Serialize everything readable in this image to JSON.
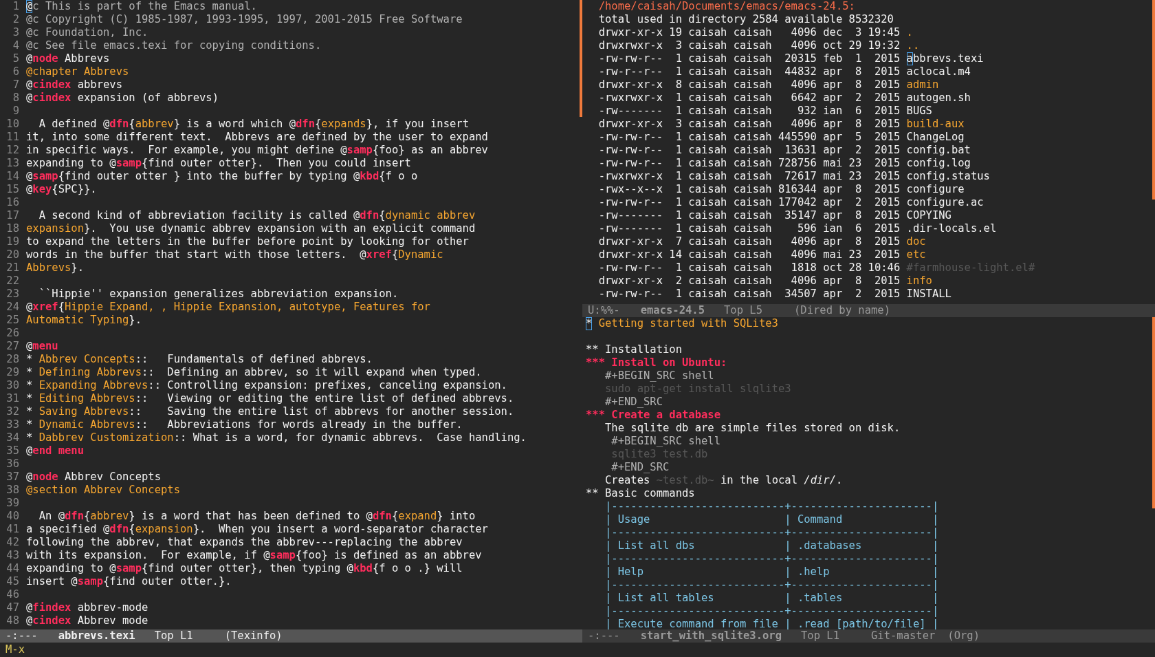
{
  "windows": [
    {
      "kind": "texinfo",
      "modeline": {
        "active": true,
        "flags": "-:---",
        "buffer": "abbrevs.texi",
        "position": "Top L1",
        "mode": "(Texinfo)"
      },
      "lines": [
        {
          "number": "1",
          "segments": [
            {
              "kind": "cursor",
              "text": "@"
            },
            {
              "kind": "comment",
              "text": "c This is part of the Emacs manual."
            }
          ]
        },
        {
          "number": "2",
          "segments": [
            {
              "kind": "comment",
              "text": "@c Copyright (C) 1985-1987, 1993-1995, 1997, 2001-2015 Free Software"
            }
          ]
        },
        {
          "number": "3",
          "segments": [
            {
              "kind": "comment",
              "text": "@c Foundation, Inc."
            }
          ]
        },
        {
          "number": "4",
          "segments": [
            {
              "kind": "comment",
              "text": "@c See file emacs.texi for copying conditions."
            }
          ]
        },
        {
          "number": "5",
          "segments": [
            {
              "kind": "text",
              "text": "@"
            },
            {
              "kind": "keyword",
              "text": "node"
            },
            {
              "kind": "text",
              "text": " Abbrevs"
            }
          ]
        },
        {
          "number": "6",
          "segments": [
            {
              "kind": "argument",
              "text": "@chapter Abbrevs"
            }
          ]
        },
        {
          "number": "7",
          "segments": [
            {
              "kind": "text",
              "text": "@"
            },
            {
              "kind": "keyword",
              "text": "cindex"
            },
            {
              "kind": "text",
              "text": " abbrevs"
            }
          ]
        },
        {
          "number": "8",
          "segments": [
            {
              "kind": "text",
              "text": "@"
            },
            {
              "kind": "keyword",
              "text": "cindex"
            },
            {
              "kind": "text",
              "text": " expansion (of abbrevs)"
            }
          ]
        },
        {
          "number": "9"
        },
        {
          "number": "10",
          "segments": [
            {
              "kind": "text",
              "text": "  A defined @"
            },
            {
              "kind": "keyword",
              "text": "dfn"
            },
            {
              "kind": "text",
              "text": "{"
            },
            {
              "kind": "argument",
              "text": "abbrev"
            },
            {
              "kind": "text",
              "text": "} is a word which @"
            },
            {
              "kind": "keyword",
              "text": "dfn"
            },
            {
              "kind": "text",
              "text": "{"
            },
            {
              "kind": "argument",
              "text": "expands"
            },
            {
              "kind": "text",
              "text": "}, if you insert"
            }
          ]
        },
        {
          "number": "11",
          "segments": [
            {
              "kind": "text",
              "text": "it, into some different text.  Abbrevs are defined by the user to expand"
            }
          ]
        },
        {
          "number": "12",
          "segments": [
            {
              "kind": "text",
              "text": "in specific ways.  For example, you might define @"
            },
            {
              "kind": "keyword",
              "text": "samp"
            },
            {
              "kind": "text",
              "text": "{foo} as an abbrev"
            }
          ]
        },
        {
          "number": "13",
          "segments": [
            {
              "kind": "text",
              "text": "expanding to @"
            },
            {
              "kind": "keyword",
              "text": "samp"
            },
            {
              "kind": "text",
              "text": "{find outer otter}.  Then you could insert"
            }
          ]
        },
        {
          "number": "14",
          "segments": [
            {
              "kind": "text",
              "text": "@"
            },
            {
              "kind": "keyword",
              "text": "samp"
            },
            {
              "kind": "text",
              "text": "{find outer otter } into the buffer by typing @"
            },
            {
              "kind": "keyword",
              "text": "kbd"
            },
            {
              "kind": "text",
              "text": "{f o o"
            }
          ]
        },
        {
          "number": "15",
          "segments": [
            {
              "kind": "text",
              "text": "@"
            },
            {
              "kind": "keyword",
              "text": "key"
            },
            {
              "kind": "text",
              "text": "{SPC}}."
            }
          ]
        },
        {
          "number": "16"
        },
        {
          "number": "17",
          "segments": [
            {
              "kind": "text",
              "text": "  A second kind of abbreviation facility is called @"
            },
            {
              "kind": "keyword",
              "text": "dfn"
            },
            {
              "kind": "text",
              "text": "{"
            },
            {
              "kind": "argument",
              "text": "dynamic abbrev"
            }
          ]
        },
        {
          "number": "18",
          "segments": [
            {
              "kind": "argument",
              "text": "expansion"
            },
            {
              "kind": "text",
              "text": "}.  You use dynamic abbrev expansion with an explicit command"
            }
          ]
        },
        {
          "number": "19",
          "segments": [
            {
              "kind": "text",
              "text": "to expand the letters in the buffer before point by looking for other"
            }
          ]
        },
        {
          "number": "20",
          "segments": [
            {
              "kind": "text",
              "text": "words in the buffer that start with those letters.  @"
            },
            {
              "kind": "keyword",
              "text": "xref"
            },
            {
              "kind": "text",
              "text": "{"
            },
            {
              "kind": "argument",
              "text": "Dynamic"
            }
          ]
        },
        {
          "number": "21",
          "segments": [
            {
              "kind": "argument",
              "text": "Abbrevs"
            },
            {
              "kind": "text",
              "text": "}."
            }
          ]
        },
        {
          "number": "22"
        },
        {
          "number": "23",
          "segments": [
            {
              "kind": "text",
              "text": "  ``Hippie'' expansion generalizes abbreviation expansion."
            }
          ]
        },
        {
          "number": "24",
          "segments": [
            {
              "kind": "text",
              "text": "@"
            },
            {
              "kind": "keyword",
              "text": "xref"
            },
            {
              "kind": "text",
              "text": "{"
            },
            {
              "kind": "argument",
              "text": "Hippie Expand, , Hippie Expansion, autotype, Features for"
            }
          ]
        },
        {
          "number": "25",
          "segments": [
            {
              "kind": "argument",
              "text": "Automatic Typing"
            },
            {
              "kind": "text",
              "text": "}."
            }
          ]
        },
        {
          "number": "26"
        },
        {
          "number": "27",
          "segments": [
            {
              "kind": "text",
              "text": "@"
            },
            {
              "kind": "keyword",
              "text": "menu"
            }
          ]
        },
        {
          "number": "28",
          "segments": [
            {
              "kind": "text",
              "text": "* "
            },
            {
              "kind": "argument",
              "text": "Abbrev Concepts"
            },
            {
              "kind": "text",
              "text": "::   Fundamentals of defined abbrevs."
            }
          ]
        },
        {
          "number": "29",
          "segments": [
            {
              "kind": "text",
              "text": "* "
            },
            {
              "kind": "argument",
              "text": "Defining Abbrevs"
            },
            {
              "kind": "text",
              "text": "::  Defining an abbrev, so it will expand when typed."
            }
          ]
        },
        {
          "number": "30",
          "segments": [
            {
              "kind": "text",
              "text": "* "
            },
            {
              "kind": "argument",
              "text": "Expanding Abbrevs"
            },
            {
              "kind": "text",
              "text": ":: Controlling expansion: prefixes, canceling expansion."
            }
          ]
        },
        {
          "number": "31",
          "segments": [
            {
              "kind": "text",
              "text": "* "
            },
            {
              "kind": "argument",
              "text": "Editing Abbrevs"
            },
            {
              "kind": "text",
              "text": "::   Viewing or editing the entire list of defined abbrevs."
            }
          ]
        },
        {
          "number": "32",
          "segments": [
            {
              "kind": "text",
              "text": "* "
            },
            {
              "kind": "argument",
              "text": "Saving Abbrevs"
            },
            {
              "kind": "text",
              "text": "::    Saving the entire list of abbrevs for another session."
            }
          ]
        },
        {
          "number": "33",
          "segments": [
            {
              "kind": "text",
              "text": "* "
            },
            {
              "kind": "argument",
              "text": "Dynamic Abbrevs"
            },
            {
              "kind": "text",
              "text": "::   Abbreviations for words already in the buffer."
            }
          ]
        },
        {
          "number": "34",
          "segments": [
            {
              "kind": "text",
              "text": "* "
            },
            {
              "kind": "argument",
              "text": "Dabbrev Customization"
            },
            {
              "kind": "text",
              "text": ":: What is a word, for dynamic abbrevs.  Case handling."
            }
          ]
        },
        {
          "number": "35",
          "segments": [
            {
              "kind": "text",
              "text": "@"
            },
            {
              "kind": "keyword",
              "text": "end menu"
            }
          ]
        },
        {
          "number": "36"
        },
        {
          "number": "37",
          "segments": [
            {
              "kind": "text",
              "text": "@"
            },
            {
              "kind": "keyword",
              "text": "node"
            },
            {
              "kind": "text",
              "text": " Abbrev Concepts"
            }
          ]
        },
        {
          "number": "38",
          "segments": [
            {
              "kind": "argument",
              "text": "@section Abbrev Concepts"
            }
          ]
        },
        {
          "number": "39"
        },
        {
          "number": "40",
          "segments": [
            {
              "kind": "text",
              "text": "  An @"
            },
            {
              "kind": "keyword",
              "text": "dfn"
            },
            {
              "kind": "text",
              "text": "{"
            },
            {
              "kind": "argument",
              "text": "abbrev"
            },
            {
              "kind": "text",
              "text": "} is a word that has been defined to @"
            },
            {
              "kind": "keyword",
              "text": "dfn"
            },
            {
              "kind": "text",
              "text": "{"
            },
            {
              "kind": "argument",
              "text": "expand"
            },
            {
              "kind": "text",
              "text": "} into"
            }
          ]
        },
        {
          "number": "41",
          "segments": [
            {
              "kind": "text",
              "text": "a specified @"
            },
            {
              "kind": "keyword",
              "text": "dfn"
            },
            {
              "kind": "text",
              "text": "{"
            },
            {
              "kind": "argument",
              "text": "expansion"
            },
            {
              "kind": "text",
              "text": "}.  When you insert a word-separator character"
            }
          ]
        },
        {
          "number": "42",
          "segments": [
            {
              "kind": "text",
              "text": "following the abbrev, that expands the abbrev---replacing the abbrev"
            }
          ]
        },
        {
          "number": "43",
          "segments": [
            {
              "kind": "text",
              "text": "with its expansion.  For example, if @"
            },
            {
              "kind": "keyword",
              "text": "samp"
            },
            {
              "kind": "text",
              "text": "{foo} is defined as an abbrev"
            }
          ]
        },
        {
          "number": "44",
          "segments": [
            {
              "kind": "text",
              "text": "expanding to @"
            },
            {
              "kind": "keyword",
              "text": "samp"
            },
            {
              "kind": "text",
              "text": "{find outer otter}, then typing @"
            },
            {
              "kind": "keyword",
              "text": "kbd"
            },
            {
              "kind": "text",
              "text": "{f o o .} will"
            }
          ]
        },
        {
          "number": "45",
          "segments": [
            {
              "kind": "text",
              "text": "insert @"
            },
            {
              "kind": "keyword",
              "text": "samp"
            },
            {
              "kind": "text",
              "text": "{find outer otter.}."
            }
          ]
        },
        {
          "number": "46"
        },
        {
          "number": "47",
          "segments": [
            {
              "kind": "text",
              "text": "@"
            },
            {
              "kind": "keyword",
              "text": "findex"
            },
            {
              "kind": "text",
              "text": " abbrev-mode"
            }
          ]
        },
        {
          "number": "48",
          "segments": [
            {
              "kind": "text",
              "text": "@"
            },
            {
              "kind": "keyword",
              "text": "cindex"
            },
            {
              "kind": "text",
              "text": " Abbrev mode"
            }
          ]
        }
      ]
    },
    {
      "kind": "dired",
      "modeline": {
        "active": false,
        "flags": "U:%%-",
        "buffer": "emacs-24.5",
        "position": "Top L5",
        "mode": "(Dired by name)"
      },
      "lines": [
        {
          "segments": [
            {
              "kind": "path",
              "text": "  /home/caisah/Documents/emacs/emacs-24.5:"
            }
          ]
        },
        {
          "segments": [
            {
              "kind": "text",
              "text": "  total used in directory 2584 available 8532320"
            }
          ]
        },
        {
          "segments": [
            {
              "kind": "text",
              "text": "  drwxr-xr-x 19 caisah caisah   4096 dec  3 19:45 "
            },
            {
              "kind": "argument",
              "text": "."
            }
          ]
        },
        {
          "segments": [
            {
              "kind": "text",
              "text": "  drwxrwxr-x  3 caisah caisah   4096 oct 29 19:32 "
            },
            {
              "kind": "argument",
              "text": ".."
            }
          ]
        },
        {
          "segments": [
            {
              "kind": "text",
              "text": "  -rw-rw-r--  1 caisah caisah  20315 feb  1  2015 "
            },
            {
              "kind": "cursor",
              "text": "a"
            },
            {
              "kind": "text",
              "text": "bbrevs.texi"
            }
          ]
        },
        {
          "segments": [
            {
              "kind": "text",
              "text": "  -rw-r--r--  1 caisah caisah  44832 apr  8  2015 aclocal.m4"
            }
          ]
        },
        {
          "segments": [
            {
              "kind": "text",
              "text": "  drwxr-xr-x  8 caisah caisah   4096 apr  8  2015 "
            },
            {
              "kind": "argument",
              "text": "admin"
            }
          ]
        },
        {
          "segments": [
            {
              "kind": "text",
              "text": "  -rwxrwxr-x  1 caisah caisah   6642 apr  2  2015 autogen.sh"
            }
          ]
        },
        {
          "segments": [
            {
              "kind": "text",
              "text": "  -rw-------  1 caisah caisah    932 ian  6  2015 BUGS"
            }
          ]
        },
        {
          "segments": [
            {
              "kind": "text",
              "text": "  drwxr-xr-x  3 caisah caisah   4096 apr  8  2015 "
            },
            {
              "kind": "argument",
              "text": "build-aux"
            }
          ]
        },
        {
          "segments": [
            {
              "kind": "text",
              "text": "  -rw-rw-r--  1 caisah caisah 445590 apr  5  2015 ChangeLog"
            }
          ]
        },
        {
          "segments": [
            {
              "kind": "text",
              "text": "  -rw-rw-r--  1 caisah caisah  13631 apr  2  2015 config.bat"
            }
          ]
        },
        {
          "segments": [
            {
              "kind": "text",
              "text": "  -rw-rw-r--  1 caisah caisah 728756 mai 23  2015 config.log"
            }
          ]
        },
        {
          "segments": [
            {
              "kind": "text",
              "text": "  -rwxrwxr-x  1 caisah caisah  72617 mai 23  2015 config.status"
            }
          ]
        },
        {
          "segments": [
            {
              "kind": "text",
              "text": "  -rwx--x--x  1 caisah caisah 816344 apr  8  2015 configure"
            }
          ]
        },
        {
          "segments": [
            {
              "kind": "text",
              "text": "  -rw-rw-r--  1 caisah caisah 177042 apr  2  2015 configure.ac"
            }
          ]
        },
        {
          "segments": [
            {
              "kind": "text",
              "text": "  -rw-------  1 caisah caisah  35147 apr  8  2015 COPYING"
            }
          ]
        },
        {
          "segments": [
            {
              "kind": "text",
              "text": "  -rw-------  1 caisah caisah    596 ian  6  2015 .dir-locals.el"
            }
          ]
        },
        {
          "segments": [
            {
              "kind": "text",
              "text": "  drwxr-xr-x  7 caisah caisah   4096 apr  8  2015 "
            },
            {
              "kind": "argument",
              "text": "doc"
            }
          ]
        },
        {
          "segments": [
            {
              "kind": "text",
              "text": "  drwxr-xr-x 14 caisah caisah   4096 mai 23  2015 "
            },
            {
              "kind": "argument",
              "text": "etc"
            }
          ]
        },
        {
          "segments": [
            {
              "kind": "text",
              "text": "  -rw-rw-r--  1 caisah caisah   1818 oct 28 10:46 "
            },
            {
              "kind": "dim",
              "text": "#farmhouse-light.el#"
            }
          ]
        },
        {
          "segments": [
            {
              "kind": "text",
              "text": "  drwxr-xr-x  2 caisah caisah   4096 apr  8  2015 "
            },
            {
              "kind": "argument",
              "text": "info"
            }
          ]
        },
        {
          "segments": [
            {
              "kind": "text",
              "text": "  -rw-rw-r--  1 caisah caisah  34507 apr  2  2015 INSTALL"
            }
          ]
        }
      ]
    },
    {
      "kind": "org",
      "modeline": {
        "active": false,
        "flags": "-:---",
        "buffer": "start_with_sqlite3.org",
        "position": "Top L1",
        "branch": "Git-master",
        "mode": "(Org)"
      },
      "lines": [
        {
          "segments": [
            {
              "kind": "cursor",
              "text": "*"
            },
            {
              "kind": "argument",
              "text": " Getting started with SQLite3"
            }
          ]
        },
        {
          "spaced": true,
          "segments": [
            {
              "kind": "text",
              "text": "** Installation"
            }
          ]
        },
        {
          "segments": [
            {
              "kind": "heading",
              "text": "*** Install on Ubuntu:"
            }
          ]
        },
        {
          "segments": [
            {
              "kind": "comment",
              "text": "   #+BEGIN_SRC shell"
            }
          ]
        },
        {
          "segments": [
            {
              "kind": "dim",
              "text": "   sudo apt-get install slqlite3"
            }
          ]
        },
        {
          "segments": [
            {
              "kind": "comment",
              "text": "   #+END_SRC"
            }
          ]
        },
        {
          "segments": [
            {
              "kind": "heading",
              "text": "*** Create a database"
            }
          ]
        },
        {
          "segments": [
            {
              "kind": "text",
              "text": "   The sqlite db are simple files stored on disk."
            }
          ]
        },
        {
          "segments": [
            {
              "kind": "comment",
              "text": "    #+BEGIN_SRC shell"
            }
          ]
        },
        {
          "segments": [
            {
              "kind": "dim",
              "text": "    sqlite3 test.db"
            }
          ]
        },
        {
          "segments": [
            {
              "kind": "comment",
              "text": "    #+END_SRC"
            }
          ]
        },
        {
          "segments": [
            {
              "kind": "text",
              "text": "   Creates "
            },
            {
              "kind": "dim",
              "text": "~test.db~"
            },
            {
              "kind": "text",
              "text": " in the local "
            },
            {
              "kind": "italic",
              "text": "/dir/"
            },
            {
              "kind": "text",
              "text": "."
            }
          ]
        },
        {
          "segments": [
            {
              "kind": "text",
              "text": "** Basic commands"
            }
          ]
        },
        {
          "segments": [
            {
              "kind": "table",
              "text": "   |---------------------------+----------------------|"
            }
          ]
        },
        {
          "segments": [
            {
              "kind": "table",
              "text": "   | Usage                     | Command              |"
            }
          ]
        },
        {
          "segments": [
            {
              "kind": "table",
              "text": "   |---------------------------+----------------------|"
            }
          ]
        },
        {
          "segments": [
            {
              "kind": "table",
              "text": "   | List all dbs              | .databases           |"
            }
          ]
        },
        {
          "segments": [
            {
              "kind": "table",
              "text": "   |---------------------------+----------------------|"
            }
          ]
        },
        {
          "segments": [
            {
              "kind": "table",
              "text": "   | Help                      | .help                |"
            }
          ]
        },
        {
          "segments": [
            {
              "kind": "table",
              "text": "   |---------------------------+----------------------|"
            }
          ]
        },
        {
          "segments": [
            {
              "kind": "table",
              "text": "   | List all tables           | .tables              |"
            }
          ]
        },
        {
          "segments": [
            {
              "kind": "table",
              "text": "   |---------------------------+----------------------|"
            }
          ]
        },
        {
          "segments": [
            {
              "kind": "table",
              "text": "   | Execute command from file | .read [path/to/file] |"
            }
          ]
        }
      ]
    }
  ],
  "minibuffer": {
    "prompt": "M-x"
  }
}
